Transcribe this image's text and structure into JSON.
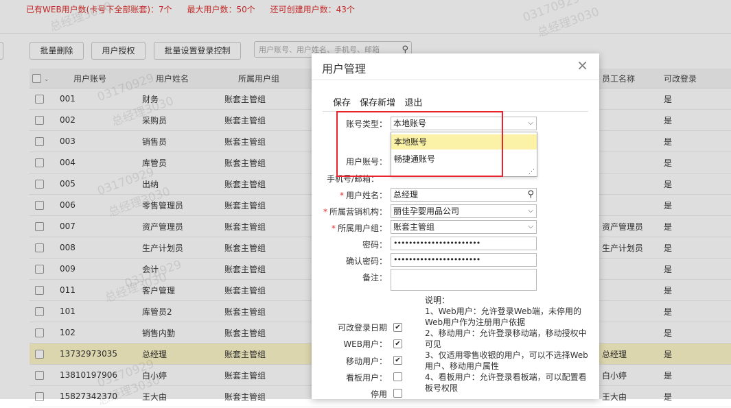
{
  "stats": {
    "web_users": "已有WEB用户数(卡号下全部账套)：7个",
    "max_users": "最大用户数：50个",
    "remaining": "还可创建用户数：43个"
  },
  "toolbar": {
    "batch_delete": "批量删除",
    "user_auth": "用户授权",
    "batch_login_control": "批量设置登录控制",
    "search_placeholder": "用户账号、用户姓名、手机号、邮箱"
  },
  "watermark": {
    "text": "03170929",
    "name_text": "总经理3030"
  },
  "table": {
    "headers": [
      "用户账号",
      "用户姓名",
      "所属用户组",
      "",
      "",
      "",
      "",
      "",
      "员工名称",
      "可改登录"
    ],
    "rows": [
      {
        "account": "001",
        "name": "财务",
        "group": "账套主管组",
        "staff": "",
        "editable": "是"
      },
      {
        "account": "002",
        "name": "采购员",
        "group": "账套主管组",
        "staff": "",
        "editable": "是"
      },
      {
        "account": "003",
        "name": "销售员",
        "group": "账套主管组",
        "staff": "",
        "editable": "是"
      },
      {
        "account": "004",
        "name": "库管员",
        "group": "账套主管组",
        "staff": "",
        "editable": "是"
      },
      {
        "account": "005",
        "name": "出纳",
        "group": "账套主管组",
        "staff": "",
        "editable": "是"
      },
      {
        "account": "006",
        "name": "零售管理员",
        "group": "账套主管组",
        "staff": "",
        "editable": "是"
      },
      {
        "account": "007",
        "name": "资产管理员",
        "group": "账套主管组",
        "staff": "资产管理员",
        "editable": "是"
      },
      {
        "account": "008",
        "name": "生产计划员",
        "group": "账套主管组",
        "staff": "生产计划员",
        "editable": "是"
      },
      {
        "account": "009",
        "name": "会计",
        "group": "账套主管组",
        "staff": "",
        "editable": "是"
      },
      {
        "account": "011",
        "name": "客户管理",
        "group": "账套主管组",
        "staff": "",
        "editable": "是"
      },
      {
        "account": "101",
        "name": "库管员2",
        "group": "账套主管组",
        "staff": "",
        "editable": "是"
      },
      {
        "account": "102",
        "name": "销售内勤",
        "group": "账套主管组",
        "staff": "",
        "editable": "是"
      },
      {
        "account": "13732973035",
        "name": "总经理",
        "group": "账套主管组",
        "staff": "总经理",
        "editable": "是"
      },
      {
        "account": "13810197906",
        "name": "白小婷",
        "group": "账套主管组",
        "staff": "白小婷",
        "editable": "是"
      },
      {
        "account": "15827342370",
        "name": "王大由",
        "group": "账套主管组",
        "staff": "王大由",
        "editable": "是"
      }
    ]
  },
  "dialog": {
    "title": "用户管理",
    "close": "×",
    "actions": {
      "save": "保存",
      "save_new": "保存新增",
      "exit": "退出"
    },
    "fields": {
      "account_type_label": "账号类型：",
      "account_type_value": "本地账号",
      "account_type_options": [
        "本地账号",
        "畅捷通账号"
      ],
      "user_account_label": "用户账号：",
      "phone_email_label": "手机号/邮箱：",
      "user_name_label": "用户姓名：",
      "user_name_value": "总经理",
      "org_label": "所属营销机构：",
      "org_value": "丽佳孕婴用品公司",
      "group_label": "所属用户组：",
      "group_value": "账套主管组",
      "password_label": "密码：",
      "password_value": "•••••••••••••••••••••••",
      "confirm_label": "确认密码：",
      "confirm_value": "•••••••••••••••••••••••",
      "remark_label": "备注："
    },
    "checks": {
      "editable_date": {
        "label": "可改登录日期",
        "checked": "✔"
      },
      "web_user": {
        "label": "WEB用户：",
        "checked": "✔"
      },
      "mobile_user": {
        "label": "移动用户：",
        "checked": "✔"
      },
      "board_user": {
        "label": "看板用户：",
        "checked": ""
      },
      "disabled": {
        "label": "停用",
        "checked": ""
      }
    },
    "notes": [
      "说明：",
      "1、Web用户：允许登录Web端，未停用的Web用户作为注册用户依据",
      "2、移动用户：允许登录移动端，移动授权中可见",
      "3、仅适用零售收银的用户，可以不选择Web用户、移动用户属性",
      "4、看板用户：允许登录看板端，可以配置看板号权限"
    ]
  }
}
